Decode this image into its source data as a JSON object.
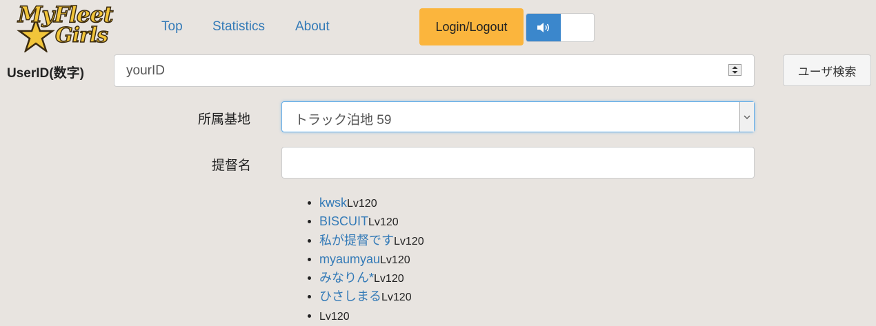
{
  "logo": {
    "line1": "MyFleet",
    "line2": "Girls"
  },
  "nav": {
    "top": "Top",
    "statistics": "Statistics",
    "about": "About"
  },
  "header": {
    "login_label": "Login/Logout"
  },
  "search": {
    "userid_label": "UserID(数字)",
    "userid_value": "yourID",
    "search_button": "ユーザ検索",
    "base_label": "所属基地",
    "base_selected": "トラック泊地 59",
    "name_label": "提督名",
    "name_value": ""
  },
  "users": [
    {
      "name": "kwsk",
      "level": "Lv120"
    },
    {
      "name": "BISCUIT",
      "level": "Lv120"
    },
    {
      "name": "私が提督です",
      "level": "Lv120"
    },
    {
      "name": "myaumyau",
      "level": "Lv120"
    },
    {
      "name": "みなりん*",
      "level": "Lv120"
    },
    {
      "name": "ひさしまる",
      "level": "Lv120"
    },
    {
      "name": "",
      "level": "Lv120"
    }
  ],
  "colors": {
    "accent": "#fbb53d",
    "link": "#337ab7",
    "toggle": "#3b87cc",
    "background": "#e8e4e0"
  }
}
